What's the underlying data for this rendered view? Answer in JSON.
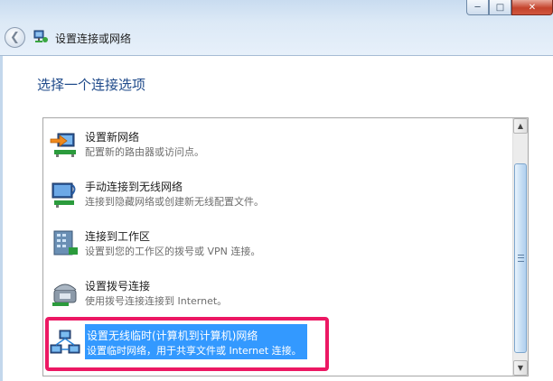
{
  "window": {
    "title": "设置连接或网络",
    "minimize_glyph": "─",
    "maximize_glyph": "□",
    "close_glyph": "✕",
    "back_glyph": "❮"
  },
  "heading": "选择一个连接选项",
  "options": [
    {
      "title": "设置新网络",
      "description": "配置新的路由器或访问点。",
      "icon": "new-network-icon",
      "selected": false
    },
    {
      "title": "手动连接到无线网络",
      "description": "连接到隐藏网络或创建新无线配置文件。",
      "icon": "wireless-manual-icon",
      "selected": false
    },
    {
      "title": "连接到工作区",
      "description": "设置到您的工作区的拨号或 VPN 连接。",
      "icon": "workplace-building-icon",
      "selected": false
    },
    {
      "title": "设置拨号连接",
      "description": "使用拨号连接连接到 Internet。",
      "icon": "dialup-phone-icon",
      "selected": false
    },
    {
      "title": "设置无线临时(计算机到计算机)网络",
      "description": "设置临时网络，用于共享文件或 Internet 连接。",
      "icon": "adhoc-network-icon",
      "selected": true
    }
  ],
  "scrollbar": {
    "up_glyph": "▲",
    "down_glyph": "▼"
  },
  "colors": {
    "selection": "#3399ff",
    "highlight_frame": "#ec1863",
    "heading": "#1f4a8a"
  }
}
